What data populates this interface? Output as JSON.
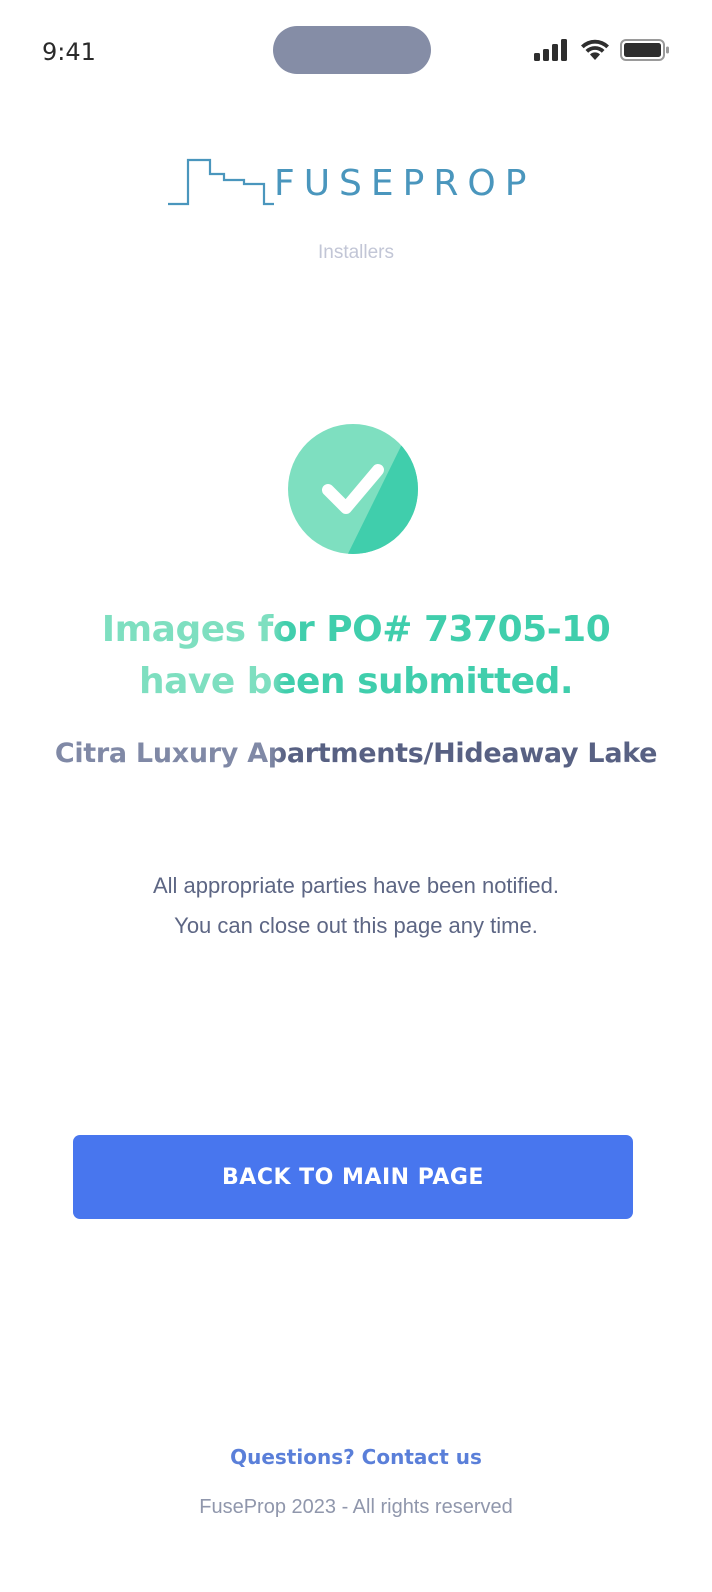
{
  "status_bar": {
    "time": "9:41",
    "island_color": "#858da6",
    "icons": [
      "signal-icon",
      "wifi-icon",
      "battery-icon"
    ]
  },
  "brand": {
    "name": "FUSEPROP",
    "color": "#4a96bd",
    "logo_icon": "skyline-icon"
  },
  "subtitle": "Installers",
  "success": {
    "icon": "checkmark-circle-icon",
    "circle_color_light": "#7edfc0",
    "circle_color_dark": "#40ceac",
    "headline_line1": "Images for PO# 73705-10",
    "headline_line2": "have been submitted.",
    "property": "Citra Luxury Apartments/Hideaway Lake"
  },
  "message": {
    "line1": "All appropriate parties have been notified.",
    "line2": "You can close out this page any time."
  },
  "actions": {
    "back_label": "BACK TO MAIN PAGE",
    "accent": "#4876ee"
  },
  "footer": {
    "contact_label": "Questions? Contact us",
    "copyright": "FuseProp 2023 - All rights reserved"
  }
}
